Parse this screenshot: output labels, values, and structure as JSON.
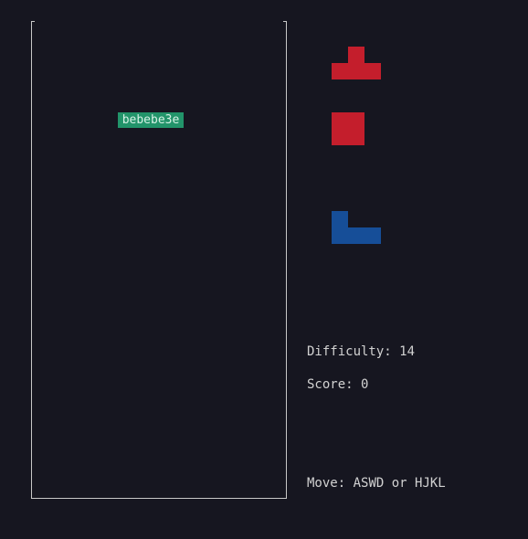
{
  "playfield": {
    "active_piece_text": "bebebe3e"
  },
  "next_pieces": [
    {
      "icon": "t-tetromino-icon",
      "color": "#c41e2c"
    },
    {
      "icon": "o-tetromino-icon",
      "color": "#c41e2c"
    },
    {
      "icon": "j-tetromino-icon",
      "color": "#164e98"
    }
  ],
  "info": {
    "difficulty_label": "Difficulty:",
    "difficulty_value": "14",
    "score_label": "Score:",
    "score_value": "0",
    "controls_label": "Move:",
    "controls_value": "ASWD or HJKL"
  }
}
